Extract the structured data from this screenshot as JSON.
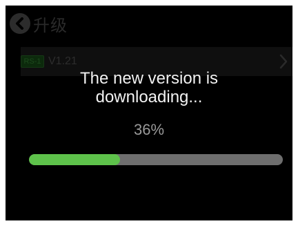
{
  "header": {
    "title": "升级",
    "back_icon": "chevron-left-icon"
  },
  "version_row": {
    "badge": "RS-1",
    "version": "V1.21",
    "chevron_icon": "chevron-right-icon"
  },
  "download": {
    "message": "The new version is downloading...",
    "percent_label": "36%",
    "progress": 0.36,
    "track_color": "#6e6e6e",
    "fill_color": "#5ec24b"
  }
}
